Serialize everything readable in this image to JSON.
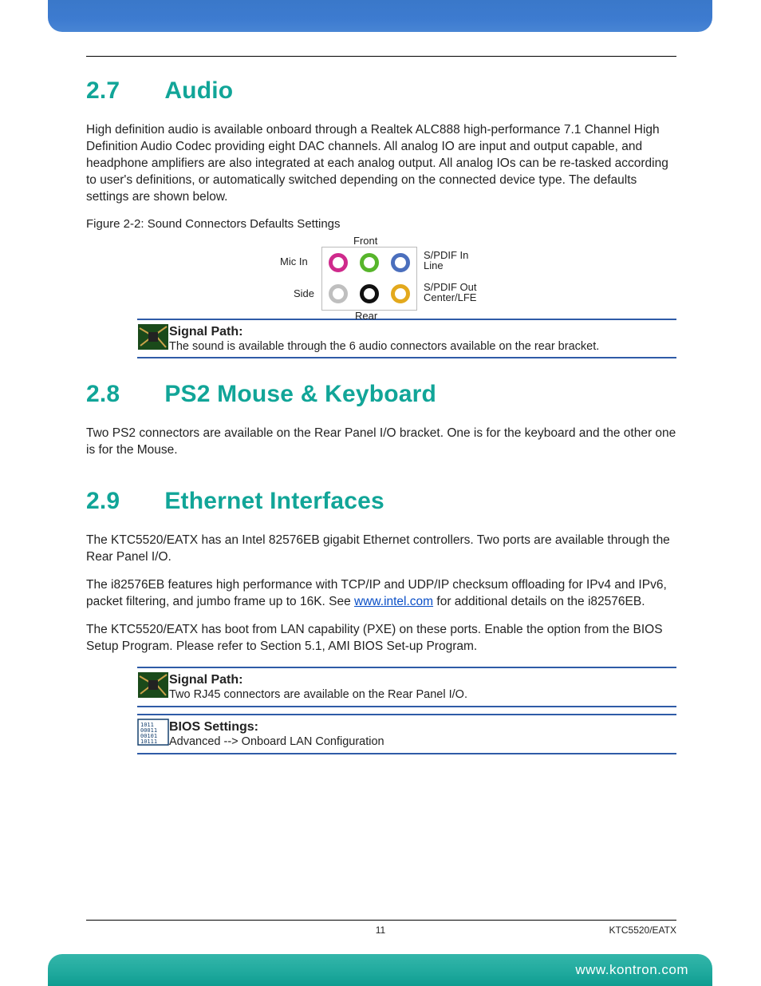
{
  "colors": {
    "accent": "#11a598",
    "rule": "#2f5ba7",
    "link": "#0a4fc7"
  },
  "sections": {
    "audio": {
      "number": "2.7",
      "title": "Audio",
      "body": "High definition audio is available onboard through a Realtek ALC888 high-performance 7.1 Channel High Definition Audio Codec providing eight DAC channels. All analog IO are input and output capable, and headphone amplifiers are also integrated at each analog output. All analog IOs can be re-tasked according to user's definitions, or automatically switched depending on the connected device type. The defaults settings are shown below.",
      "figure_caption": "Figure 2-2: Sound Connectors Defaults Settings",
      "connector_labels": {
        "mic_in": "Mic In",
        "front": "Front",
        "spdif_in_line": "S/PDIF In Line",
        "side": "Side",
        "rear": "Rear",
        "spdif_out_center_lfe": "S/PDIF Out Center/LFE"
      },
      "connector_colors": {
        "mic_in": "#cf2a8c",
        "front": "#57b52b",
        "spdif_in": "#4b6fbd",
        "side": "#bfbfbf",
        "rear": "#111111",
        "spdif_out": "#e3a91d"
      },
      "signal_path": {
        "title": "Signal Path:",
        "body": "The sound is available through the 6 audio connectors available on the rear bracket."
      }
    },
    "ps2": {
      "number": "2.8",
      "title": "PS2 Mouse & Keyboard",
      "body": "Two PS2 connectors are available on the Rear Panel I/O bracket. One is for the keyboard and the other one is for the Mouse."
    },
    "eth": {
      "number": "2.9",
      "title": "Ethernet Interfaces",
      "body1": "The KTC5520/EATX has an Intel 82576EB gigabit Ethernet controllers. Two ports are available through the Rear Panel I/O.",
      "body2_pre": "The i82576EB features high performance with TCP/IP and UDP/IP checksum offloading for IPv4 and IPv6, packet filtering, and jumbo frame up to 16K. See ",
      "link_text": "www.intel.com",
      "link_href": "http://www.intel.com",
      "body2_post": " for additional details on the i82576EB.",
      "body3": "The KTC5520/EATX has boot from LAN capability (PXE) on these ports. Enable the option from the BIOS Setup Program. Please refer to Section 5.1, AMI BIOS Set-up Program.",
      "signal_path": {
        "title": "Signal Path:",
        "body": "Two RJ45 connectors are available on the Rear Panel I/O."
      },
      "bios": {
        "title": "BIOS Settings:",
        "body": "Advanced --> Onboard LAN Configuration"
      }
    }
  },
  "footer": {
    "page_number": "11",
    "doc_id": "KTC5520/EATX",
    "url": "www.kontron.com"
  }
}
